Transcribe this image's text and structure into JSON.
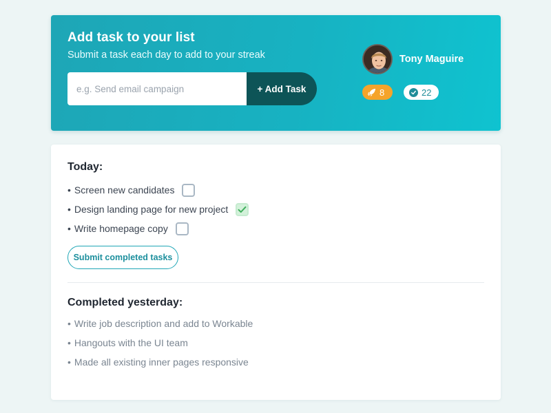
{
  "header": {
    "title": "Add task to your list",
    "subtitle": "Submit a task each day to add to your streak",
    "input_placeholder": "e.g. Send email campaign",
    "input_value": "",
    "add_button_label": "+ Add Task",
    "colors": {
      "gradient_start": "#1ea6b6",
      "gradient_end": "#0fc3d0",
      "add_button": "#0d5457"
    }
  },
  "profile": {
    "name": "Tony Maguire",
    "avatar_icon": "user-photo",
    "streak": {
      "icon": "rocket-icon",
      "count": "8",
      "color": "#f5a42a"
    },
    "completed": {
      "icon": "check-circle-icon",
      "count": "22",
      "color": "#1f8d99"
    }
  },
  "today": {
    "heading": "Today:",
    "tasks": [
      {
        "label": "Screen new candidates",
        "checked": false
      },
      {
        "label": "Design landing page for new project",
        "checked": true
      },
      {
        "label": "Write homepage copy",
        "checked": false
      }
    ],
    "submit_label": "Submit completed tasks"
  },
  "yesterday": {
    "heading": "Completed yesterday:",
    "tasks": [
      "Write job description and add to Workable",
      "Hangouts with the UI team",
      "Made all existing inner pages responsive"
    ]
  },
  "bullet": "•"
}
